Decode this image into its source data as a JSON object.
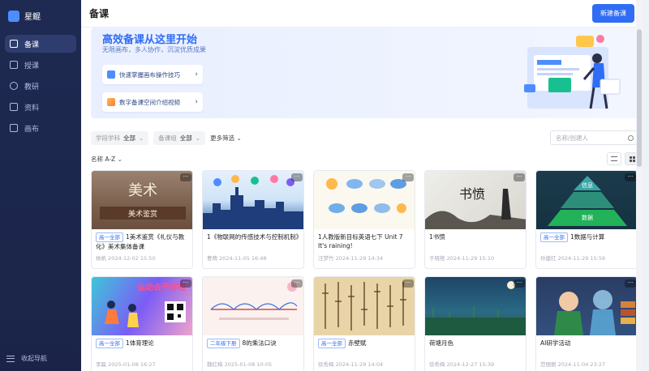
{
  "app": {
    "name": "星鲲"
  },
  "sidebar": {
    "items": [
      {
        "label": "备课",
        "icon": "book-icon",
        "active": true
      },
      {
        "label": "授课",
        "icon": "board-icon",
        "active": false
      },
      {
        "label": "教研",
        "icon": "people-icon",
        "active": false
      },
      {
        "label": "资料",
        "icon": "folder-icon",
        "active": false
      },
      {
        "label": "画布",
        "icon": "canvas-icon",
        "active": false
      }
    ],
    "collapse_label": "收起导航"
  },
  "header": {
    "title": "备课",
    "new_button": "新建备课"
  },
  "banner": {
    "title": "高效备课从这里开始",
    "subtitle": "无限画布，多人协作，沉淀优质成果",
    "links": [
      {
        "label": "快速掌握画布操作技巧"
      },
      {
        "label": "数字备课空间介绍视频"
      }
    ]
  },
  "filters": {
    "subject_label": "学段学科",
    "subject_value": "全部",
    "group_label": "备课组",
    "group_value": "全部",
    "more": "更多筛选",
    "search_placeholder": "名称/创建人"
  },
  "sort": {
    "label": "名称 A-Z"
  },
  "cards": [
    {
      "tag": "高一全部",
      "title": "1美术鉴赏《礼仪与教化》美术集体备课",
      "meta": "杨帆 2024-12-02 15:50",
      "thumb_text": "美术鉴赏"
    },
    {
      "tag": "",
      "title": "1《物联网的传感技术与控制机制》",
      "meta": "曹晴 2024-11-05 16:48",
      "thumb_text": ""
    },
    {
      "tag": "",
      "title": "1人教版新目标英语七下 Unit 7 It's raining!",
      "meta": "汪梦竹 2024-11-29 14:34",
      "thumb_text": ""
    },
    {
      "tag": "",
      "title": "1书愤",
      "meta": "于晓艳 2024-11-29 15:10",
      "thumb_text": "书愤"
    },
    {
      "tag": "高一全部",
      "title": "1数据与计算",
      "meta": "孙建红 2024-11-29 15:56",
      "thumb_text": "信息 / 数据"
    },
    {
      "tag": "高一全部",
      "title": "1体育理论",
      "meta": "李磊 2025-01-08 16:27",
      "thumb_text": "运动会开锣啦"
    },
    {
      "tag": "二年级下册",
      "title": "8的乘法口诀",
      "meta": "魏红梅 2025-01-08 10:05",
      "thumb_text": ""
    },
    {
      "tag": "高一全部",
      "title": "赤壁赋",
      "meta": "徐秀梅 2024-11-29 14:04",
      "thumb_text": ""
    },
    {
      "tag": "",
      "title": "荷塘月色",
      "meta": "徐秀梅 2024-12-27 15:39",
      "thumb_text": ""
    },
    {
      "tag": "",
      "title": "AI研学活动",
      "meta": "范丽丽 2024-11-04 23:27",
      "thumb_text": ""
    }
  ]
}
